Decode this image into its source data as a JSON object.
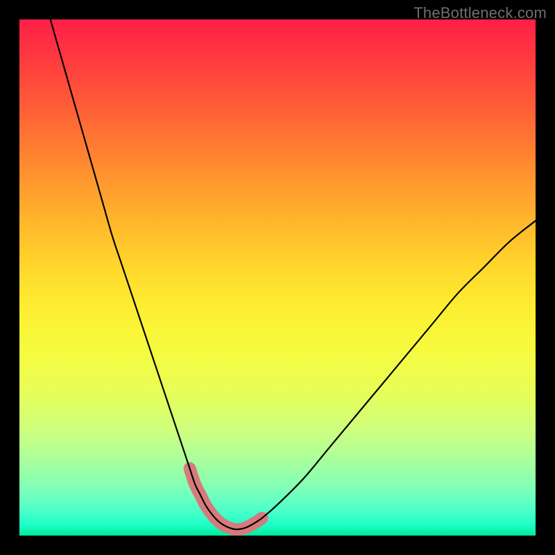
{
  "watermark": "TheBottleneck.com",
  "chart_data": {
    "type": "line",
    "title": "",
    "xlabel": "",
    "ylabel": "",
    "legend": false,
    "grid": false,
    "xlim": [
      0,
      100
    ],
    "ylim": [
      0,
      100
    ],
    "series": [
      {
        "name": "bottleneck-curve",
        "x": [
          6,
          8,
          10,
          12,
          14,
          16,
          18,
          20,
          22,
          24,
          26,
          28,
          30,
          32,
          33,
          34,
          35,
          36,
          37,
          38,
          39,
          40,
          41,
          42,
          43,
          44,
          45,
          47,
          50,
          55,
          60,
          65,
          70,
          75,
          80,
          85,
          90,
          95,
          100
        ],
        "y": [
          100,
          93,
          86,
          79,
          72,
          65,
          58,
          52,
          46,
          40,
          34,
          28,
          22,
          16,
          13,
          10,
          8,
          6,
          4.5,
          3.3,
          2.4,
          1.8,
          1.4,
          1.2,
          1.3,
          1.6,
          2.1,
          3.4,
          6,
          11,
          17,
          23,
          29,
          35,
          41,
          47,
          52,
          57,
          61
        ]
      },
      {
        "name": "highlight-band",
        "x": [
          33,
          34,
          35,
          36,
          37,
          38,
          39,
          40,
          41,
          42,
          43,
          44,
          45,
          46,
          47
        ],
        "y": [
          13,
          10,
          8,
          6,
          4.5,
          3.3,
          2.4,
          1.8,
          1.4,
          1.2,
          1.3,
          1.6,
          2.1,
          2.7,
          3.4
        ]
      }
    ],
    "colors": {
      "curve": "#000000",
      "highlight": "#d77a7c",
      "gradient_top": "#ff1f48",
      "gradient_bottom": "#00e89a"
    }
  }
}
